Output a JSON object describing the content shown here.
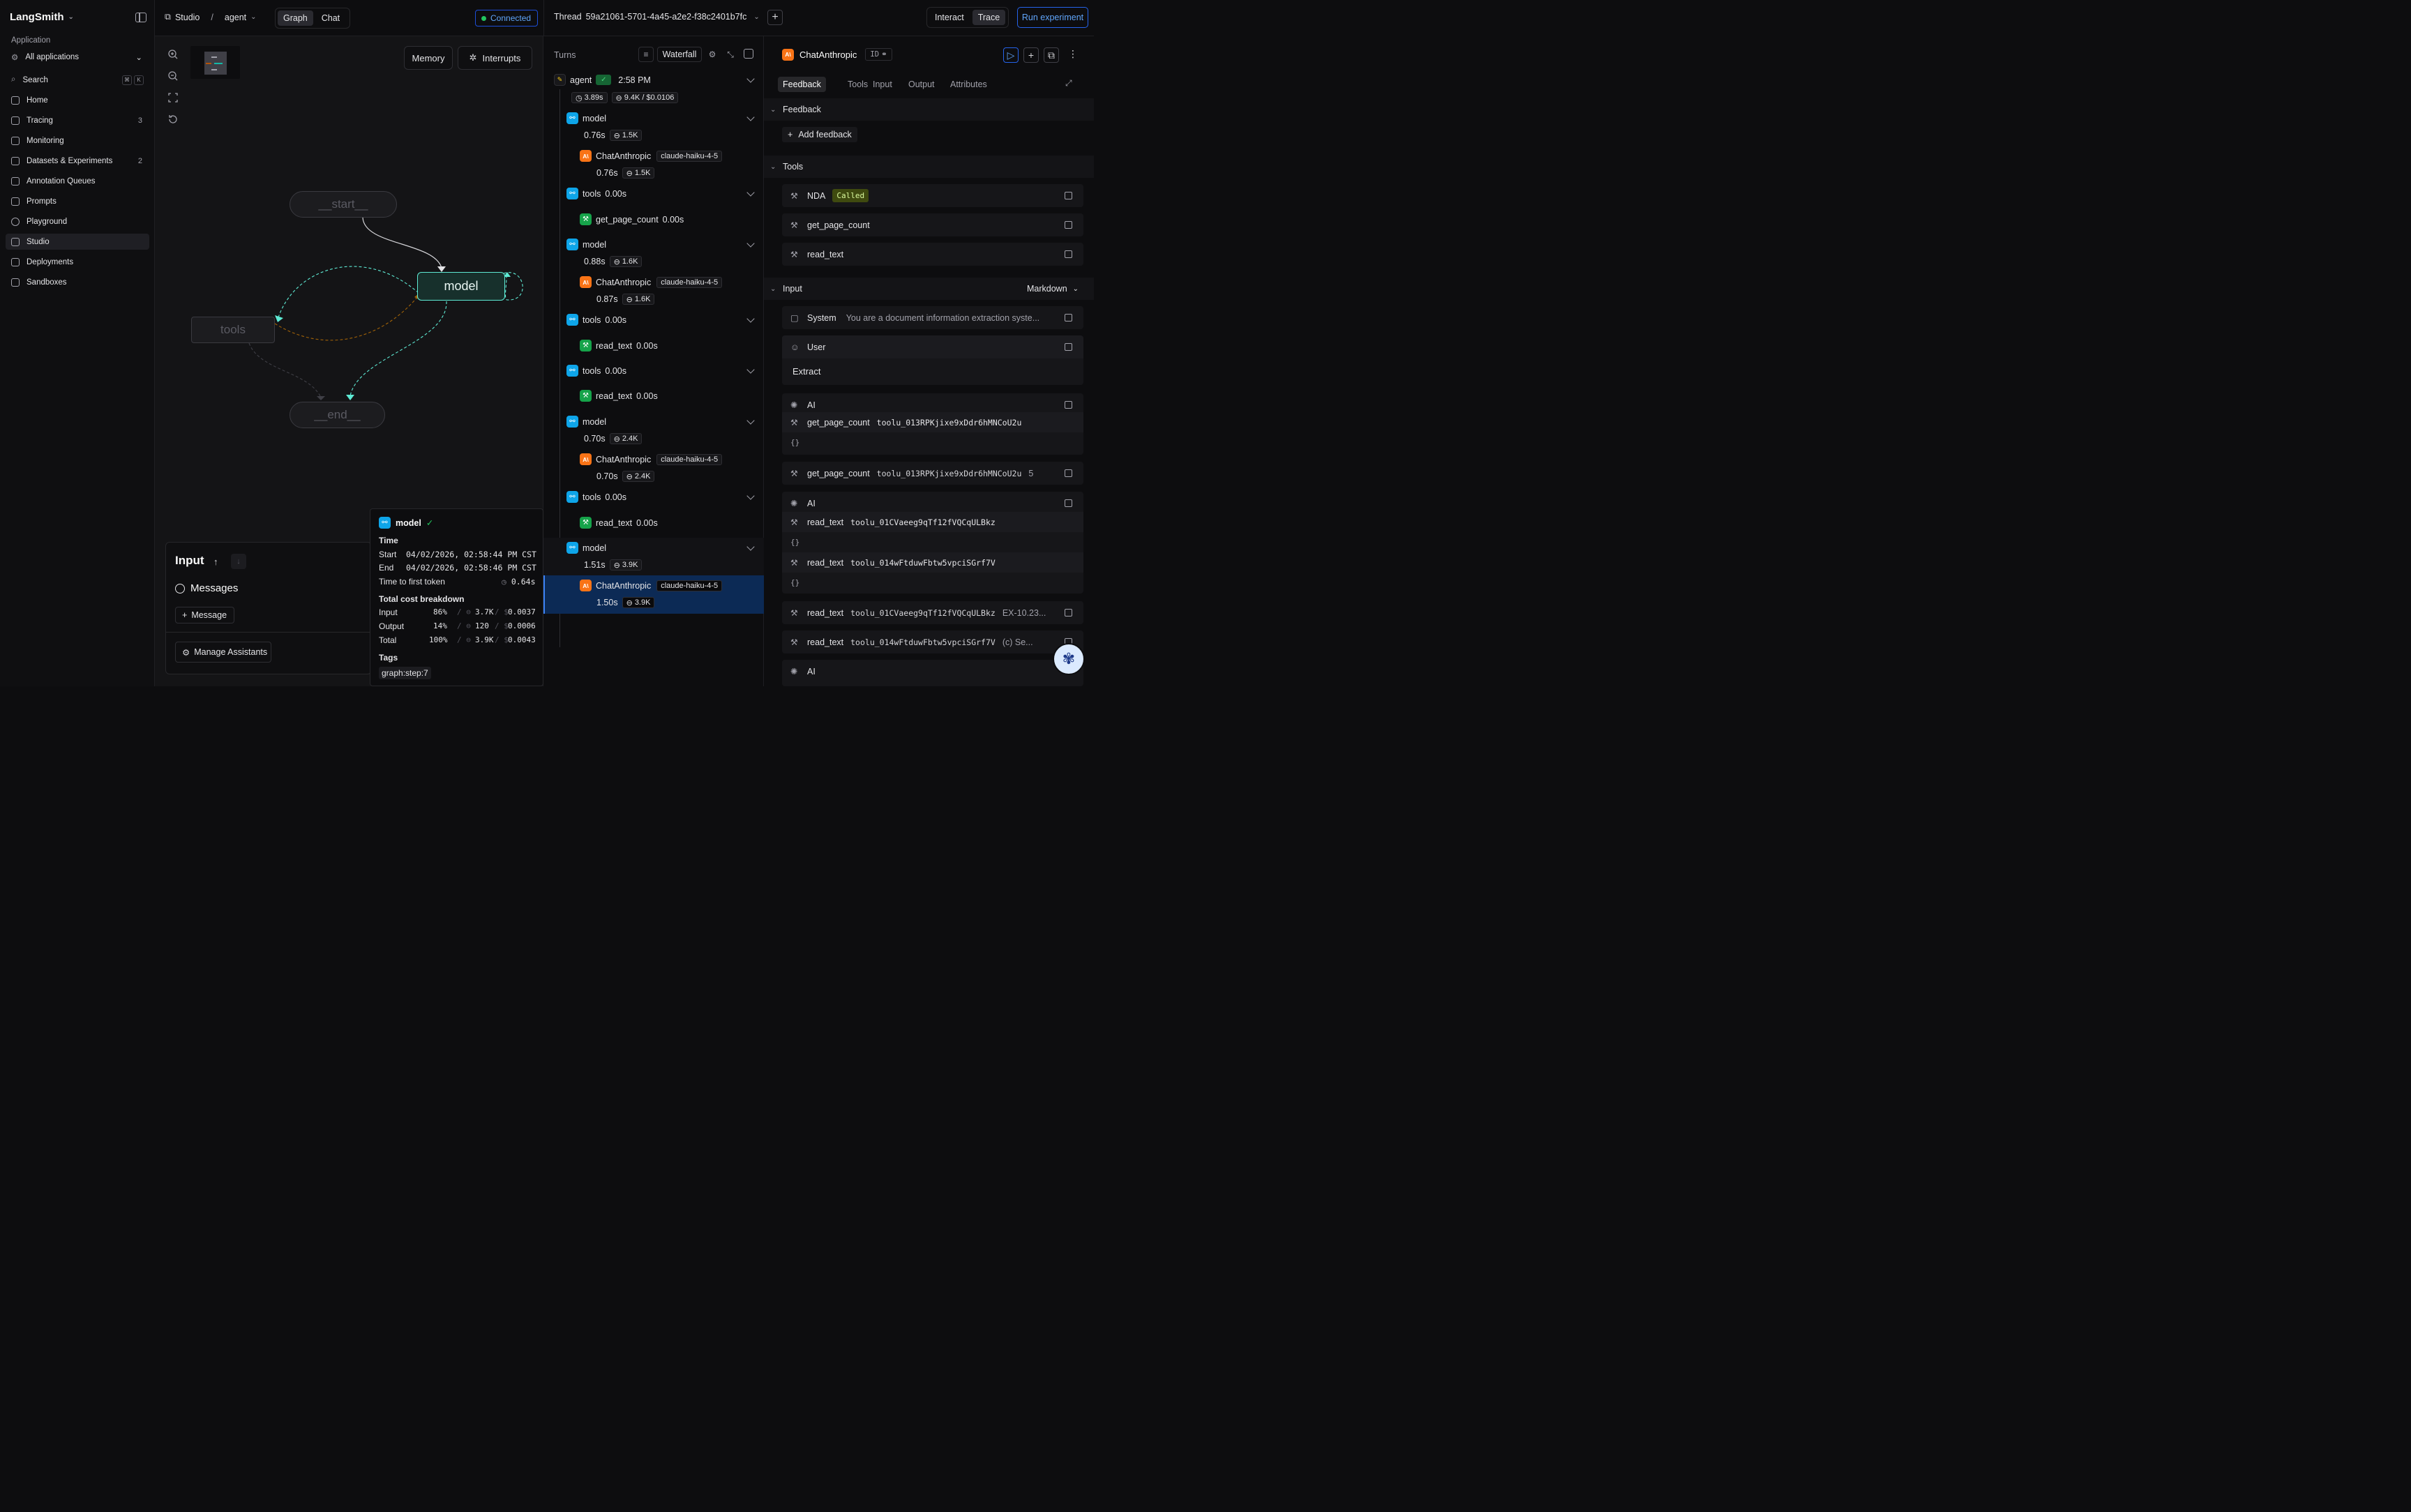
{
  "sidebar": {
    "brand": "LangSmith",
    "section_label": "Application",
    "app_select": "All applications",
    "search": "Search",
    "kbd": [
      "⌘",
      "K"
    ],
    "items": [
      {
        "label": "Home",
        "count": ""
      },
      {
        "label": "Tracing",
        "count": "3"
      },
      {
        "label": "Monitoring",
        "count": ""
      },
      {
        "label": "Datasets & Experiments",
        "count": "2"
      },
      {
        "label": "Annotation Queues",
        "count": ""
      },
      {
        "label": "Prompts",
        "count": ""
      },
      {
        "label": "Playground",
        "count": ""
      },
      {
        "label": "Studio",
        "count": ""
      },
      {
        "label": "Deployments",
        "count": ""
      },
      {
        "label": "Sandboxes",
        "count": ""
      }
    ]
  },
  "topbar": {
    "studio": "Studio",
    "sep": "/",
    "graph_name": "agent",
    "view_tabs": [
      "Graph",
      "Chat"
    ],
    "status": "Connected",
    "thread_label": "Thread",
    "thread_id": "59a21061-5701-4a45-a2e2-f38c2401b7fc",
    "mode_tabs": [
      "Interact",
      "Trace"
    ],
    "run_experiment": "Run experiment"
  },
  "graph": {
    "buttons": {
      "memory": "Memory",
      "interrupts": "Interrupts"
    },
    "nodes": {
      "start": "__start__",
      "model": "model",
      "tools": "tools",
      "end": "__end__"
    },
    "input_panel": {
      "title": "Input",
      "messages": "Messages",
      "add_message": "Message",
      "manage": "Manage Assistants"
    },
    "tooltip": {
      "name": "model",
      "time_heading": "Time",
      "start_label": "Start",
      "start_value": "04/02/2026, 02:58:44 PM CST",
      "end_label": "End",
      "end_value": "04/02/2026, 02:58:46 PM CST",
      "ttft_label": "Time to first token",
      "ttft_value": "0.64s",
      "cost_heading": "Total cost breakdown",
      "rows": [
        {
          "label": "Input",
          "pct": "86%",
          "tokens": "3.7K",
          "cost": "0.0037"
        },
        {
          "label": "Output",
          "pct": "14%",
          "tokens": "120",
          "cost": "0.0006"
        },
        {
          "label": "Total",
          "pct": "100%",
          "tokens": "3.9K",
          "cost": "0.0043"
        }
      ],
      "tags_heading": "Tags",
      "tag": "graph:step:7"
    }
  },
  "turns": {
    "title": "Turns",
    "view": "Waterfall",
    "root": {
      "name": "agent",
      "time": "2:58 PM",
      "duration": "3.89s",
      "tokens": "9.4K / $0.0106"
    },
    "model_tag": "claude-haiku-4-5",
    "rows": [
      {
        "kind": "model",
        "name": "model",
        "duration": "0.76s",
        "tokens": "1.5K"
      },
      {
        "kind": "llm",
        "name": "ChatAnthropic",
        "duration": "0.76s",
        "tokens": "1.5K"
      },
      {
        "kind": "tools",
        "name": "tools",
        "duration": "0.00s"
      },
      {
        "kind": "tool",
        "name": "get_page_count",
        "duration": "0.00s"
      },
      {
        "kind": "model",
        "name": "model",
        "duration": "0.88s",
        "tokens": "1.6K"
      },
      {
        "kind": "llm",
        "name": "ChatAnthropic",
        "duration": "0.87s",
        "tokens": "1.6K"
      },
      {
        "kind": "tools",
        "name": "tools",
        "duration": "0.00s"
      },
      {
        "kind": "tool",
        "name": "read_text",
        "duration": "0.00s"
      },
      {
        "kind": "tools",
        "name": "tools",
        "duration": "0.00s"
      },
      {
        "kind": "tool",
        "name": "read_text",
        "duration": "0.00s"
      },
      {
        "kind": "model",
        "name": "model",
        "duration": "0.70s",
        "tokens": "2.4K"
      },
      {
        "kind": "llm",
        "name": "ChatAnthropic",
        "duration": "0.70s",
        "tokens": "2.4K"
      },
      {
        "kind": "tools",
        "name": "tools",
        "duration": "0.00s"
      },
      {
        "kind": "tool",
        "name": "read_text",
        "duration": "0.00s"
      },
      {
        "kind": "model",
        "name": "model",
        "duration": "1.51s",
        "tokens": "3.9K"
      },
      {
        "kind": "llm",
        "name": "ChatAnthropic",
        "duration": "1.50s",
        "tokens": "3.9K"
      }
    ]
  },
  "detail": {
    "title": "ChatAnthropic",
    "id_badge": "ID",
    "tabs": [
      "Feedback",
      "Tools",
      "Input",
      "Output",
      "Attributes"
    ],
    "feedback_heading": "Feedback",
    "add_feedback": "Add feedback",
    "tools_heading": "Tools",
    "tools": [
      {
        "name": "NDA",
        "badge": "Called"
      },
      {
        "name": "get_page_count",
        "badge": ""
      },
      {
        "name": "read_text",
        "badge": ""
      }
    ],
    "input_heading": "Input",
    "format": "Markdown",
    "system_label": "System",
    "system_text": "You are a document information extraction syste...",
    "user_label": "User",
    "user_text": "Extract",
    "ai_label": "AI",
    "ai1_call_name": "get_page_count",
    "ai1_call_id": "toolu_013RPKjixe9xDdr6hMNCoU2u",
    "braces": "{}",
    "tool_msg1": {
      "name": "get_page_count",
      "id": "toolu_013RPKjixe9xDdr6hMNCoU2u",
      "value": "5"
    },
    "ai2_calls": [
      {
        "name": "read_text",
        "id": "toolu_01CVaeeg9qTf12fVQCqULBkz"
      },
      {
        "name": "read_text",
        "id": "toolu_014wFtduwFbtw5vpciSGrf7V"
      }
    ],
    "tool_msg2": {
      "name": "read_text",
      "id": "toolu_01CVaeeg9qTf12fVQCqULBkz",
      "value": "EX-10.23..."
    },
    "tool_msg3": {
      "name": "read_text",
      "id": "toolu_014wFtduwFbtw5vpciSGrf7V",
      "value": "(c)    Se..."
    }
  },
  "colors": {
    "accent": "#2563eb",
    "connected": "#22c55e",
    "node_model": "#5eead4",
    "selected_row": "#0c2a55"
  }
}
